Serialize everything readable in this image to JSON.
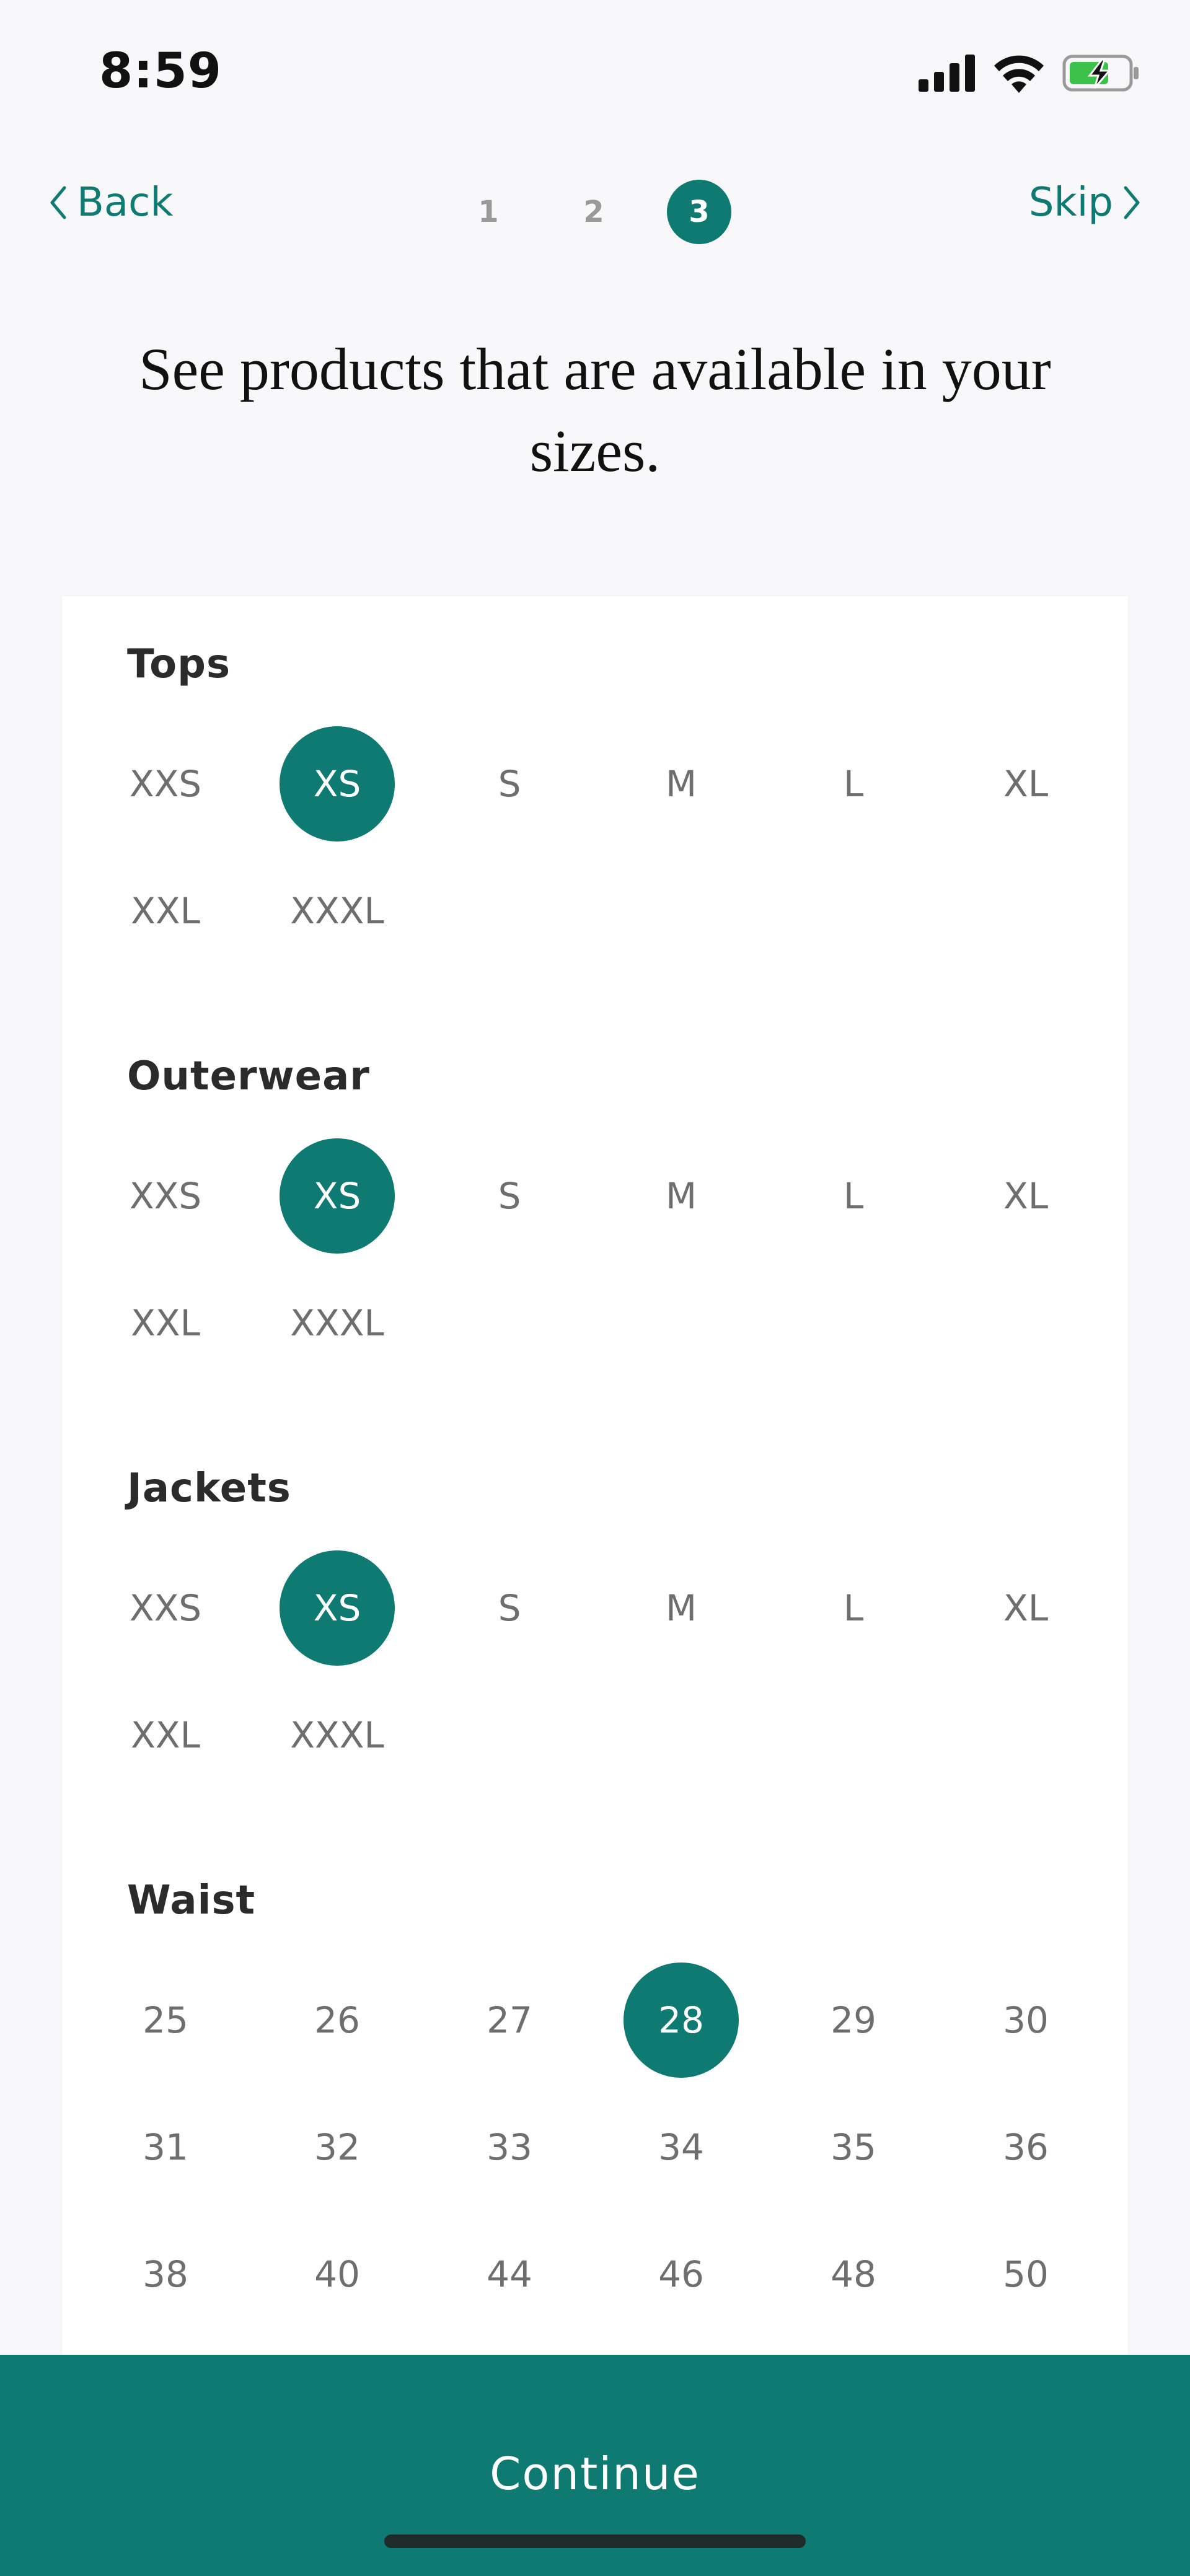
{
  "status_bar": {
    "time": "8:59",
    "icons": [
      "signal-icon",
      "wifi-icon",
      "battery-charging-icon"
    ]
  },
  "nav": {
    "back_label": "Back",
    "skip_label": "Skip",
    "steps": [
      "1",
      "2",
      "3"
    ],
    "active_step": "3"
  },
  "headline": "See products that are available in your sizes.",
  "sections": [
    {
      "title": "Tops",
      "sizes": [
        "XXS",
        "XS",
        "S",
        "M",
        "L",
        "XL",
        "XXL",
        "XXXL"
      ],
      "selected": "XS"
    },
    {
      "title": "Outerwear",
      "sizes": [
        "XXS",
        "XS",
        "S",
        "M",
        "L",
        "XL",
        "XXL",
        "XXXL"
      ],
      "selected": "XS"
    },
    {
      "title": "Jackets",
      "sizes": [
        "XXS",
        "XS",
        "S",
        "M",
        "L",
        "XL",
        "XXL",
        "XXXL"
      ],
      "selected": "XS"
    },
    {
      "title": "Waist",
      "sizes": [
        "25",
        "26",
        "27",
        "28",
        "29",
        "30",
        "31",
        "32",
        "33",
        "34",
        "35",
        "36",
        "38",
        "40",
        "44",
        "46",
        "48",
        "50"
      ],
      "selected": "28"
    }
  ],
  "continue_label": "Continue",
  "colors": {
    "accent": "#0e7a72",
    "background": "#f8f8fa",
    "card": "#ffffff",
    "unselected_text": "#6e6e6e"
  }
}
